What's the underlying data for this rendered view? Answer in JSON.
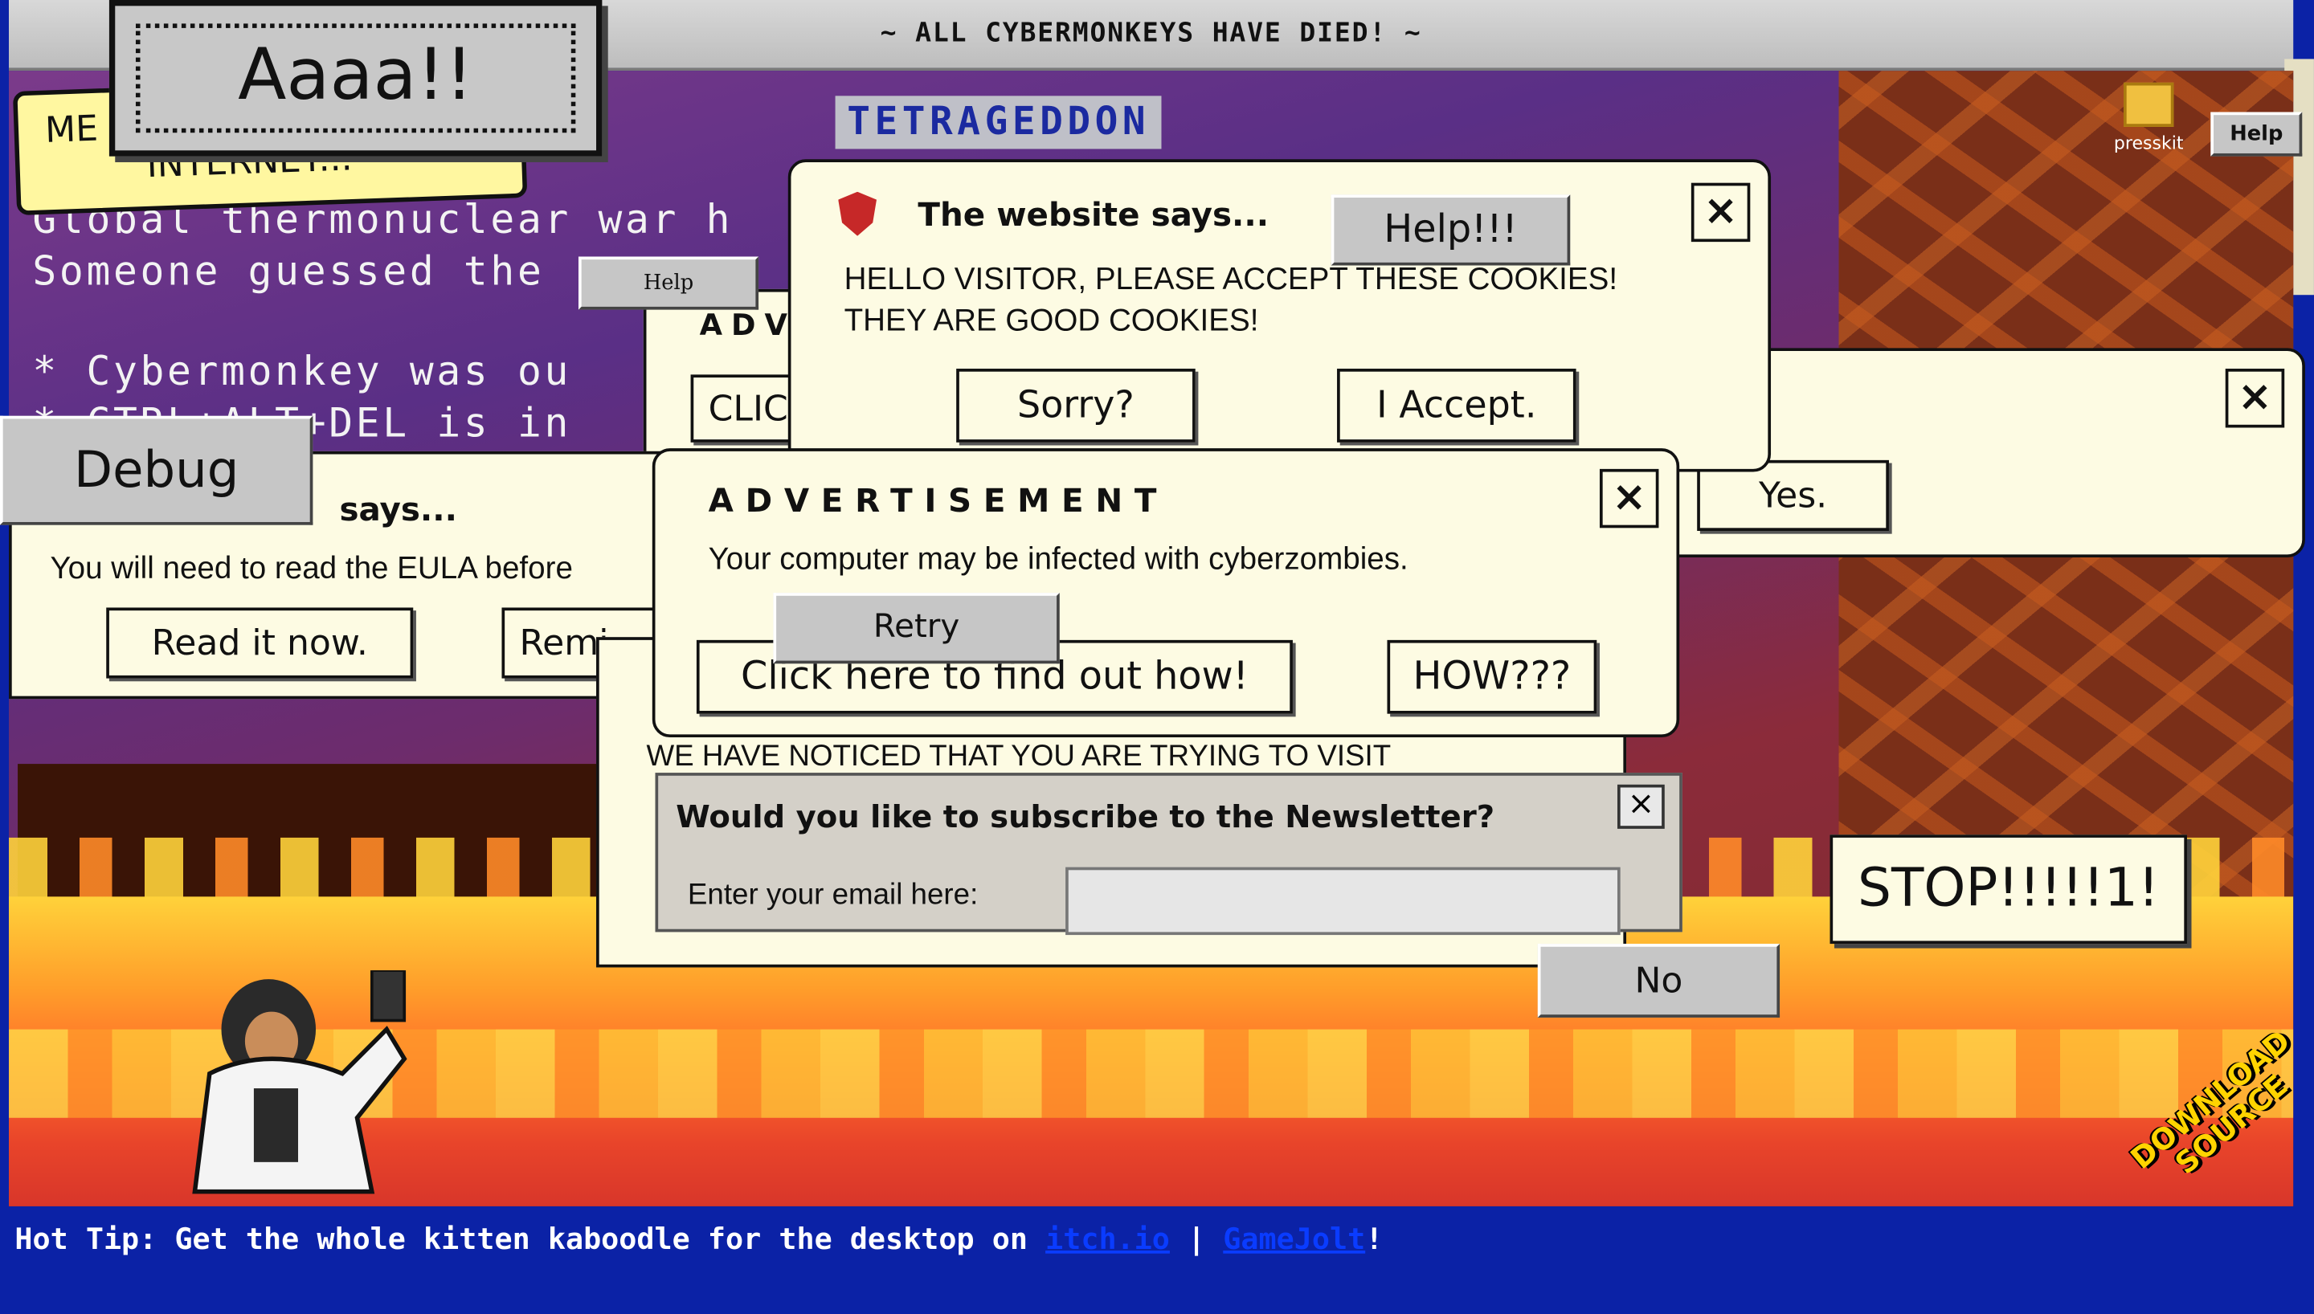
{
  "title_bar": {
    "title": "~ ALL CYBERMONKEYS HAVE DIED! ~"
  },
  "game_title": "TETRAGEDDON",
  "speech_bubble": {
    "line1": "ME",
    "line2": "INTERNET..."
  },
  "background_text": {
    "line1": "Global thermonuclear war h",
    "line2": "Someone guessed the",
    "line3": "*  Cybermonkey was ou",
    "line4": "*  CTRL+ALT+DEL is in"
  },
  "aaaa_button": {
    "label": "Aaaa!!"
  },
  "debug_button": {
    "label": "Debug"
  },
  "small_help_button": {
    "label": "Help"
  },
  "cookie_dialog": {
    "title": "The website says...",
    "message_line1": "HELLO VISITOR, PLEASE ACCEPT THESE COOKIES!",
    "message_line2": "THEY ARE GOOD COOKIES!",
    "sorry_label": "Sorry?",
    "accept_label": "I Accept.",
    "close_label": "×"
  },
  "help_dialog_button": {
    "label": "Help!!!"
  },
  "partial_ad_window": {
    "title": "ADV",
    "button_label": "CLIC"
  },
  "eula_dialog": {
    "title": "says...",
    "message": "You will need to read the EULA before",
    "read_label": "Read it now.",
    "remind_label": "Remi"
  },
  "right_dialog": {
    "yes_label": "Yes.",
    "close_label": "×"
  },
  "ad_dialog": {
    "title": "ADVERTISEMENT",
    "message": "Your computer may be infected with cyberzombies.",
    "click_label": "Click here to find out how!",
    "how_label": "HOW???",
    "close_label": "×"
  },
  "retry_button": {
    "label": "Retry"
  },
  "visit_dialog": {
    "message": "WE HAVE NOTICED THAT YOU ARE TRYING TO VISIT"
  },
  "newsletter_dialog": {
    "title": "Would you like to subscribe to the Newsletter?",
    "email_label": "Enter your email here:",
    "email_value": "",
    "close_label": "×"
  },
  "no_button": {
    "label": "No"
  },
  "stop_button": {
    "label": "STOP!!!!!1!"
  },
  "desktop": {
    "presskit_label": "presskit",
    "help_label": "Help"
  },
  "download_badge": {
    "line1": "DOWNLOAD",
    "line2": "SOURCE"
  },
  "hot_tip": {
    "prefix": "Hot Tip: Get the whole kitten kaboodle for the desktop on ",
    "itch_label": "itch.io",
    "separator": " | ",
    "gamejolt_label": "GameJolt",
    "suffix": "!"
  },
  "colors": {
    "page_background": "#0b22a6",
    "dialog_background": "#fdfbe3",
    "link": "#0a3cff",
    "fire_yellow": "#ffd23a",
    "fire_red": "#e8442a"
  }
}
